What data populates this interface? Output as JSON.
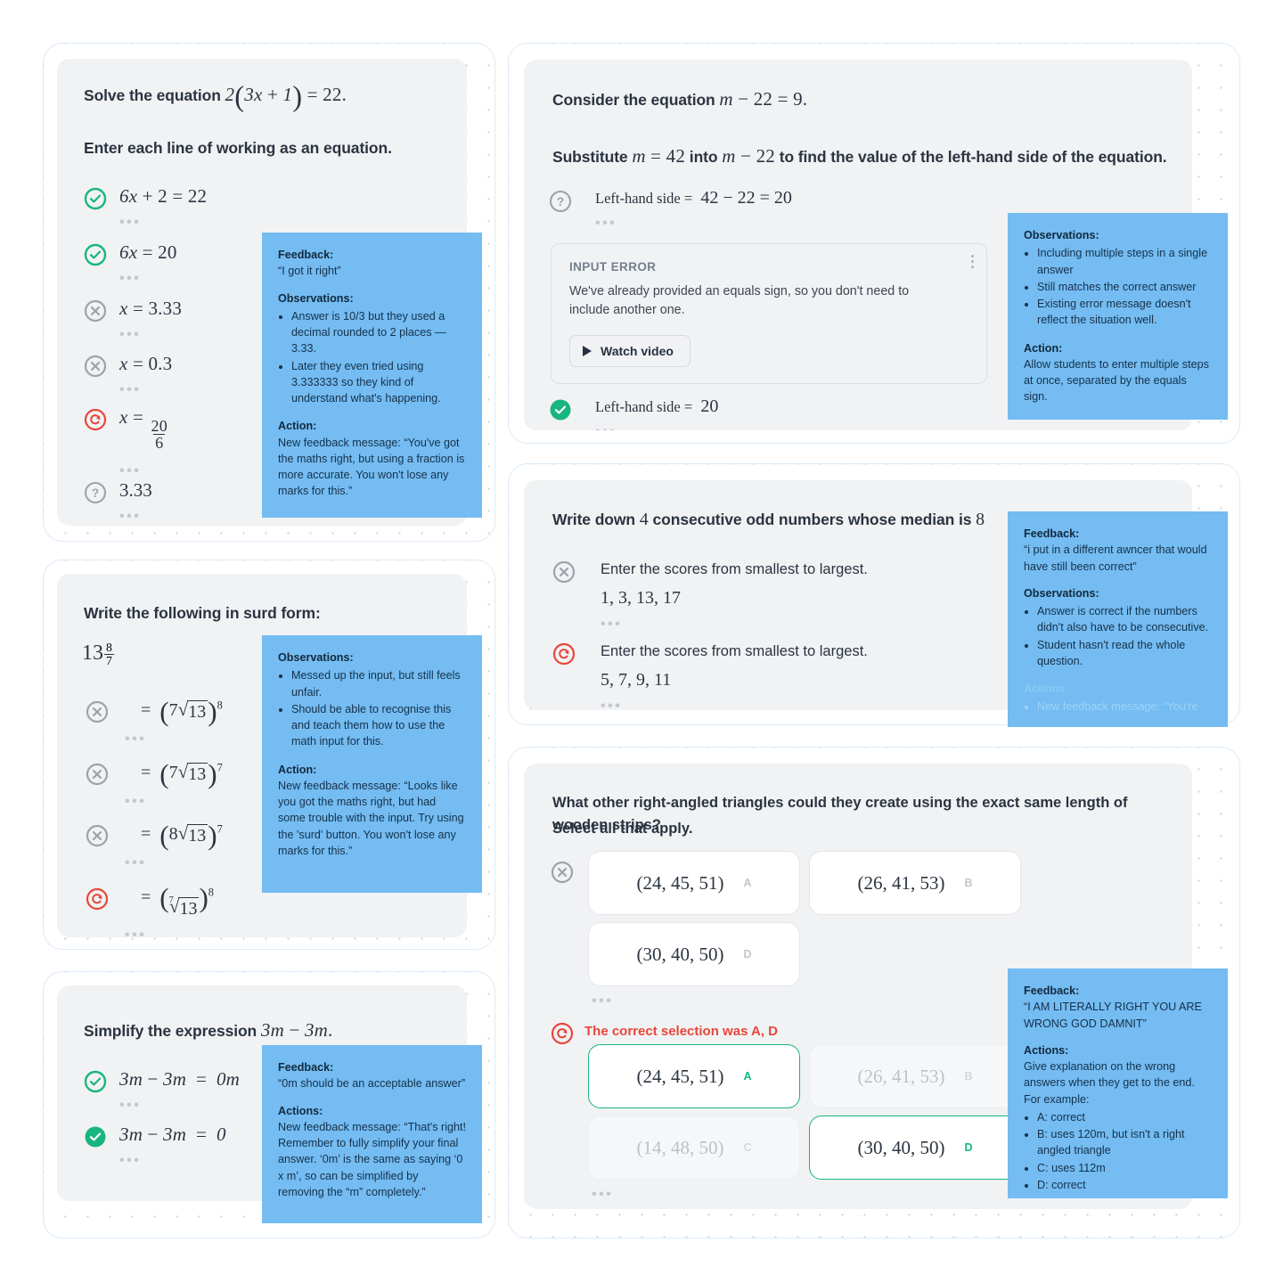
{
  "panels": {
    "solve_equation": {
      "name": "Solve the equation",
      "heading_prefix": "Solve the equation ",
      "heading_math": "2(3x + 1) = 22.",
      "instruction": "Enter each line of working as an equation.",
      "rows": [
        {
          "status": "correct",
          "value": "6x + 2 = 22"
        },
        {
          "status": "correct",
          "value": "6x = 20"
        },
        {
          "status": "incorrect",
          "value": "x = 3.33"
        },
        {
          "status": "incorrect",
          "value": "x = 0.3"
        },
        {
          "status": "retry",
          "value": "x = 20/6"
        },
        {
          "status": "unknown",
          "value": "3.33"
        }
      ],
      "note": {
        "feedback_label": "Feedback:",
        "feedback_text": "“I got it right”",
        "observations_label": "Observations:",
        "observations": [
          "Answer is 10/3 but they used a decimal rounded to 2 places — 3.33.",
          "Later they even tried using 3.333333 so they kind of understand what's happening."
        ],
        "action_label": "Action:",
        "action_text": "New feedback message: “You've got the maths right, but using a fraction is more accurate. You won't lose any marks for this.”"
      }
    },
    "surd_form": {
      "name": "Write the following in surd form",
      "heading": "Write the following in surd form:",
      "expression": "13^(8/7)",
      "rows": [
        {
          "status": "incorrect",
          "value": "= (7√13)^8"
        },
        {
          "status": "incorrect",
          "value": "= (7√13)^7"
        },
        {
          "status": "incorrect",
          "value": "= (8√13)^7"
        },
        {
          "status": "retry",
          "value": "= (⁷√13)^8"
        }
      ],
      "note": {
        "observations_label": "Observations:",
        "observations": [
          "Messed up the input, but still feels unfair.",
          "Should be able to recognise this and teach them how to use the math input for this."
        ],
        "action_label": "Action:",
        "action_text": "New feedback message: “Looks like you got the maths right, but had some trouble with the input. Try using the 'surd' button. You won't lose any marks for this.”"
      }
    },
    "simplify": {
      "name": "Simplify the expression",
      "heading_prefix": "Simplify the expression ",
      "heading_math": "3m − 3m.",
      "rows": [
        {
          "status": "correct-outline",
          "value": "3m − 3m = 0m"
        },
        {
          "status": "correct-filled",
          "value": "3m − 3m = 0"
        }
      ],
      "note": {
        "feedback_label": "Feedback:",
        "feedback_text": "“0m should be an acceptable answer”",
        "actions_label": "Actions:",
        "actions_text": "New feedback message: “That's right! Remember to fully simplify your final answer. ‘0m’ is the same as saying ‘0 x m’, so can be simplified by removing the “m” completely.”"
      }
    },
    "substitute": {
      "name": "Consider the equation",
      "heading_prefix": "Consider the equation ",
      "heading_math": "m − 22 = 9.",
      "instruction_parts": {
        "a": "Substitute ",
        "m1": "m = 42",
        "b": " into ",
        "m2": "m − 22",
        "c": " to find the value of the left-hand side of the equation."
      },
      "row_attempt": {
        "status": "unknown",
        "label": "Left-hand side = ",
        "value": "42 − 22 = 20"
      },
      "error_box": {
        "title": "INPUT ERROR",
        "body": "We've already provided an equals sign, so you don't need to include another one.",
        "button": "Watch video",
        "kebab": "more-options"
      },
      "row_final": {
        "status": "correct-filled",
        "label": "Left-hand side = ",
        "value": "20"
      },
      "note": {
        "observations_label": "Observations:",
        "observations": [
          "Including multiple steps in a single answer",
          "Still matches the correct answer",
          "Existing error message doesn't reflect the situation well."
        ],
        "action_label": "Action:",
        "action_text": "Allow students to enter multiple steps at once, separated by the equals sign."
      }
    },
    "median": {
      "name": "Write down 4 consecutive odd numbers",
      "heading_a": "Write down ",
      "heading_num": "4",
      "heading_b": " consecutive odd numbers whose median is ",
      "heading_c": "8",
      "rows": [
        {
          "status": "incorrect",
          "prompt": "Enter the scores from smallest to largest.",
          "value": "1, 3, 13, 17"
        },
        {
          "status": "retry",
          "prompt": "Enter the scores from smallest to largest.",
          "value": "5, 7, 9, 11"
        }
      ],
      "note": {
        "feedback_label": "Feedback:",
        "feedback_text": "“i put in a different awncer that would have still been correct”",
        "observations_label": "Observations:",
        "observations": [
          "Answer is correct if the numbers didn't also have to be consecutive.",
          "Student hasn't read the whole question."
        ],
        "actions_label": "Actions:",
        "actions_cut": "New feedback message: “You're"
      }
    },
    "triangles": {
      "name": "Right-angled triangles multiple choice",
      "heading_line1": "What other right-angled triangles could they create using the exact same length of wooden strips?",
      "heading_line2": "Select all that apply.",
      "attempt_status": "incorrect",
      "attempt_options": [
        {
          "value": "(24, 45, 51)",
          "letter": "A",
          "state": "default"
        },
        {
          "value": "(26, 41, 53)",
          "letter": "B",
          "state": "default"
        },
        {
          "value": "(30, 40, 50)",
          "letter": "D",
          "state": "default"
        }
      ],
      "correct_status": "retry",
      "correct_message": "The correct selection was A, D",
      "correct_options": [
        {
          "value": "(24, 45, 51)",
          "letter": "A",
          "state": "correct"
        },
        {
          "value": "(26, 41, 53)",
          "letter": "B",
          "state": "dim"
        },
        {
          "value": "(14, 48, 50)",
          "letter": "C",
          "state": "dim"
        },
        {
          "value": "(30, 40, 50)",
          "letter": "D",
          "state": "correct"
        }
      ],
      "note": {
        "feedback_label": "Feedback:",
        "feedback_text": "“I AM LITERALLY RIGHT YOU ARE WRONG GOD DAMNIT”",
        "actions_label": "Actions:",
        "actions_intro": "Give explanation on the wrong answers when they get to the end. For example:",
        "actions": [
          "A: correct",
          "B: uses 120m, but isn't a right angled triangle",
          "C: uses 112m",
          "D: correct"
        ]
      }
    }
  },
  "colors": {
    "green": "#19b57f",
    "grey_icon": "#9aa3ab",
    "red": "#e8463a",
    "note_blue": "#74bcf2",
    "card_grey": "#f1f2f4",
    "panel_border": "#dceaf7"
  },
  "icon_names": {
    "correct": "check-circle-icon",
    "incorrect": "cross-circle-icon",
    "retry": "retry-circle-icon",
    "unknown": "question-circle-icon",
    "play": "play-icon",
    "kebab": "more-vertical-icon"
  }
}
